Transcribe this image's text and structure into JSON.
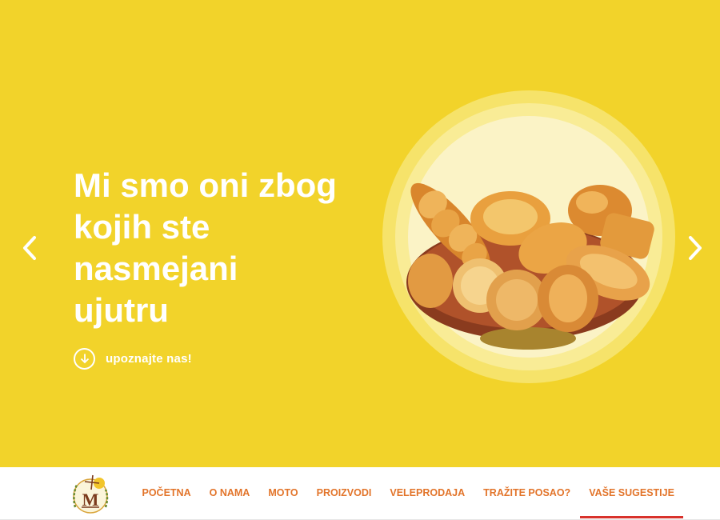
{
  "hero": {
    "headline": "Mi smo oni zbog kojih ste nasmejani ujutru",
    "cta_label": "upoznajte nas!",
    "cta_icon": "arrow-down-circle-icon",
    "prev_icon": "chevron-left-icon",
    "next_icon": "chevron-right-icon",
    "image": "basket-of-pastries",
    "background_color": "#f2d32a"
  },
  "nav": {
    "logo": "windmill-wheat-logo",
    "items": [
      {
        "label": "POČETNA"
      },
      {
        "label": "O NAMA"
      },
      {
        "label": "MOTO"
      },
      {
        "label": "PROIZVODI"
      },
      {
        "label": "VELEPRODAJA"
      },
      {
        "label": "TRAŽITE POSAO?"
      },
      {
        "label": "VAŠE SUGESTIJE",
        "active": true
      }
    ],
    "text_color": "#e2742a",
    "active_color": "#d8322c"
  }
}
